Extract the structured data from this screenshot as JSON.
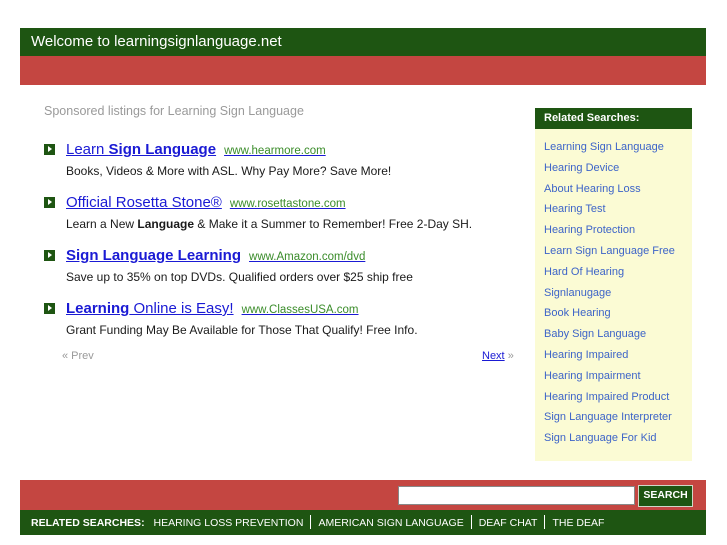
{
  "header": {
    "title": "Welcome to learningsignlanguage.net"
  },
  "sponsored_label": "Sponsored listings for Learning Sign Language",
  "listings": [
    {
      "title_parts": [
        "Learn ",
        "Sign Language"
      ],
      "url": "www.hearmore.com",
      "desc_parts": [
        "Books, Videos & More with ASL. Why Pay More? Save More!"
      ]
    },
    {
      "title_parts": [
        "Official Rosetta Stone®"
      ],
      "url": "www.rosettastone.com",
      "desc_parts": [
        "Learn a New ",
        "Language",
        " & Make it a Summer to Remember! Free 2-Day SH."
      ]
    },
    {
      "title_parts": [
        "Sign Language Learning"
      ],
      "url": "www.Amazon.com/dvd",
      "desc_parts": [
        "Save up to 35% on top DVDs. Qualified orders over $25 ship free"
      ]
    },
    {
      "title_parts": [
        "Learning",
        " Online is Easy!"
      ],
      "url": "www.ClassesUSA.com",
      "desc_parts": [
        "Grant Funding May Be Available for Those That Qualify! Free Info."
      ]
    }
  ],
  "pager": {
    "prev": "« Prev",
    "next": "Next",
    "next_arrow": "»"
  },
  "related": {
    "heading": "Related Searches:",
    "items": [
      "Learning Sign Language",
      "Hearing Device",
      "About Hearing Loss",
      "Hearing Test",
      "Hearing Protection",
      "Learn Sign Language Free",
      "Hard Of Hearing",
      "Signlanugage",
      "Book Hearing",
      "Baby Sign Language",
      "Hearing Impaired",
      "Hearing Impairment",
      "Hearing Impaired Product",
      "Sign Language Interpreter",
      "Sign Language For Kid"
    ]
  },
  "search": {
    "button_label": "SEARCH",
    "value": ""
  },
  "footer": {
    "label": "RELATED SEARCHES:",
    "links": [
      "HEARING LOSS PREVENTION",
      "AMERICAN SIGN LANGUAGE",
      "DEAF CHAT",
      "THE DEAF"
    ]
  },
  "colors": {
    "dark_green": "#1e5512",
    "red": "#c44641",
    "link_blue": "#1a1ad4",
    "url_green": "#3a8c2a",
    "related_bg": "#fbfbd4"
  }
}
